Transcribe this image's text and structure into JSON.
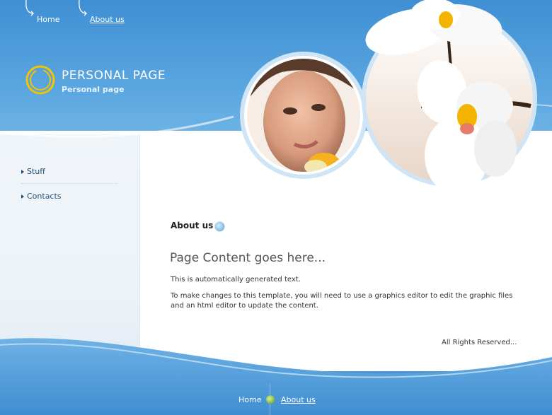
{
  "top_nav": {
    "home_label": "Home",
    "about_label": "About us"
  },
  "site": {
    "title": "PERSONAL PAGE",
    "subtitle": "Personal page"
  },
  "sidebar": {
    "items": [
      {
        "label": "Stuff"
      },
      {
        "label": "Contacts"
      }
    ]
  },
  "content": {
    "breadcrumb": "About us",
    "heading": "Page Content goes here...",
    "paragraph1": "This is automatically generated text.",
    "paragraph2": "To make changes to this template, you will need to use a graphics editor to edit the graphic files and an html editor to update the content.",
    "rights": "All Rights Reserved..."
  },
  "footer_nav": {
    "home_label": "Home",
    "about_label": "About us"
  },
  "colors": {
    "sky_blue": "#4a96d6",
    "logo_ring": "#f2c300",
    "nav_text": "#1f4f78"
  },
  "icons": {
    "logo": "ring-logo-icon",
    "menu_bullet": "triangle-bullet-icon",
    "breadcrumb_dot": "blue-orb-icon",
    "footer_dot": "green-orb-icon"
  }
}
